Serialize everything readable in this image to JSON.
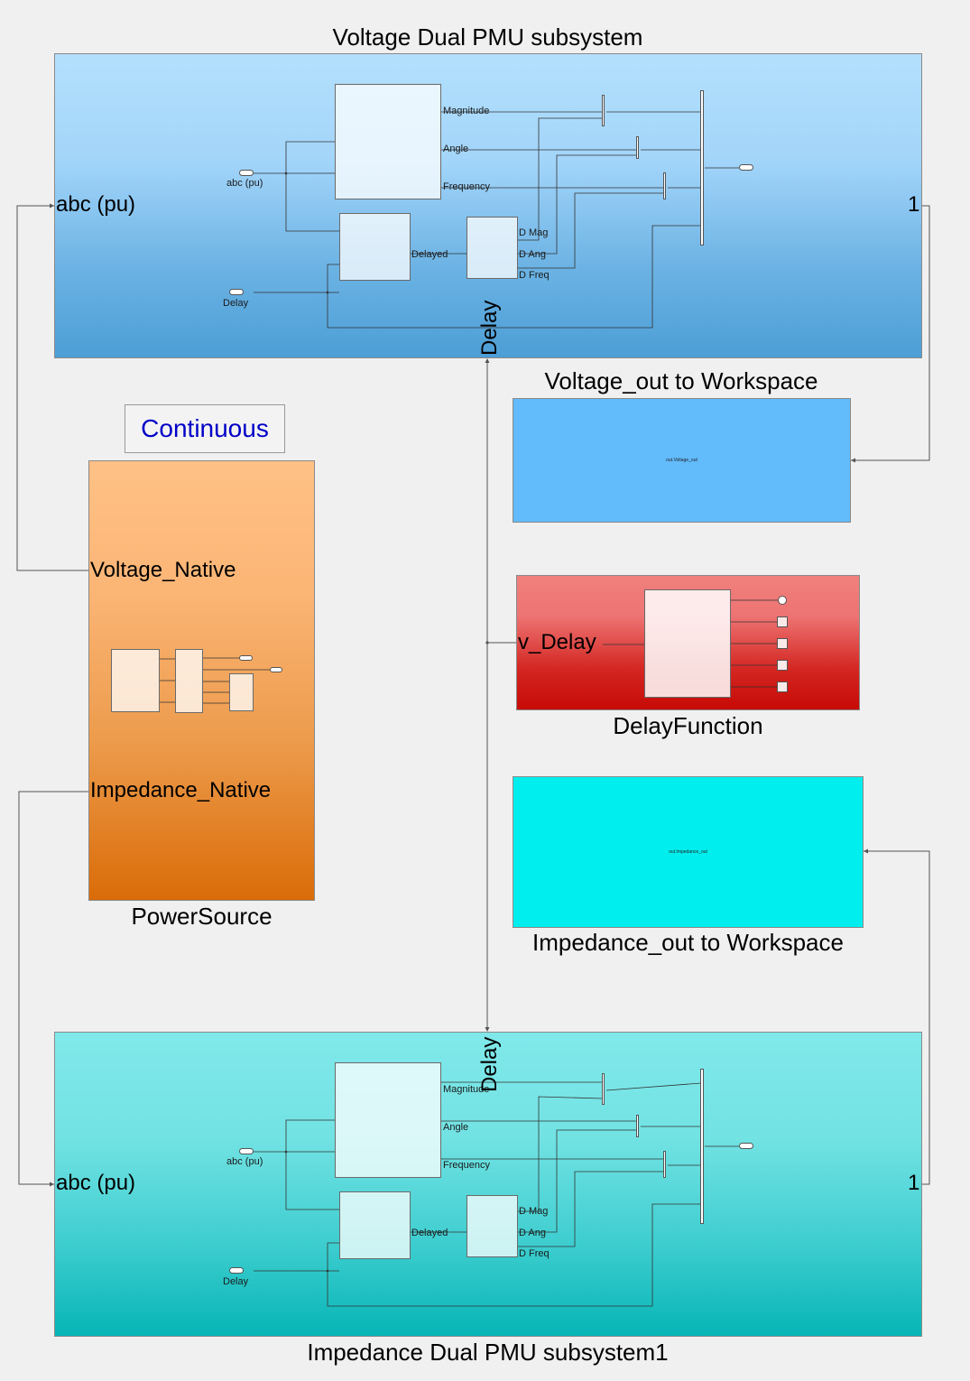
{
  "voltage_pmu": {
    "title": "Voltage Dual PMU subsystem",
    "in_port": "abc (pu)",
    "out_port": "1",
    "delay_port": "Delay",
    "inner": {
      "abc_label": "abc (pu)",
      "delay_label": "Delay",
      "magnitude": "Magnitude",
      "angle": "Angle",
      "frequency": "Frequency",
      "delayed": "Delayed",
      "d_mag": "D Mag",
      "d_ang": "D Ang",
      "d_freq": "D Freq"
    }
  },
  "impedance_pmu": {
    "title": "Impedance Dual PMU subsystem1",
    "in_port": "abc (pu)",
    "out_port": "1",
    "delay_port": "Delay",
    "inner": {
      "abc_label": "abc (pu)",
      "delay_label": "Delay",
      "magnitude": "Magnitude",
      "angle": "Angle",
      "frequency": "Frequency",
      "delayed": "Delayed",
      "d_mag": "D Mag",
      "d_ang": "D Ang",
      "d_freq": "D Freq"
    }
  },
  "continuous": {
    "label": "Continuous",
    "color": "#0000c8"
  },
  "power_source": {
    "title": "PowerSource",
    "voltage_port": "Voltage_Native",
    "impedance_port": "Impedance_Native"
  },
  "voltage_workspace": {
    "title": "Voltage_out to Workspace",
    "content": "out.Voltage_out",
    "color": "#62bbfb"
  },
  "delay_function": {
    "title": "DelayFunction",
    "port": "v_Delay"
  },
  "impedance_workspace": {
    "title": "Impedance_out to Workspace",
    "content": "out.Impedance_out",
    "color": "#00eeee"
  }
}
